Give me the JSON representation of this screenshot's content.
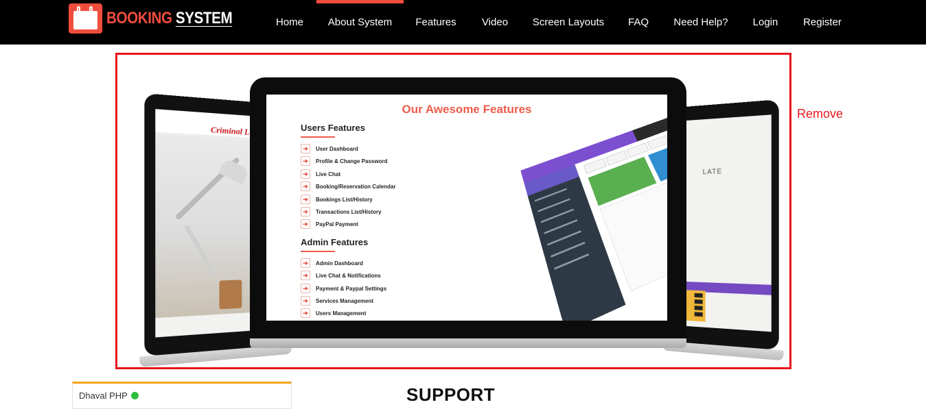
{
  "header": {
    "logo": {
      "word1": "BOOKING",
      "word2": "SYSTEM"
    },
    "nav": [
      {
        "label": "Home"
      },
      {
        "label": "About System",
        "active": true
      },
      {
        "label": "Features"
      },
      {
        "label": "Video"
      },
      {
        "label": "Screen Layouts"
      },
      {
        "label": "FAQ"
      },
      {
        "label": "Need Help?"
      },
      {
        "label": "Login"
      },
      {
        "label": "Register"
      }
    ]
  },
  "slider": {
    "remove_label": "Remove",
    "left_screen_script": "Criminal L",
    "right_screen_title": "LATE",
    "main_screen": {
      "title": "Our Awesome Features",
      "sections": [
        {
          "title": "Users Features",
          "items": [
            "User Dashboard",
            "Profile & Change Password",
            "Live Chat",
            "Booking/Reservation Calendar",
            "Bookings List/History",
            "Transactions List/History",
            "PayPal Payment"
          ]
        },
        {
          "title": "Admin Features",
          "items": [
            "Admin Dashboard",
            "Live Chat & Notifications",
            "Payment & Paypal Settings",
            "Services Management",
            "Users Management"
          ]
        }
      ]
    }
  },
  "chat": {
    "agent_name": "Dhaval PHP",
    "status_color": "#2ebd3f"
  },
  "support_heading": "SUPPORT",
  "colors": {
    "accent": "#ef4d3d",
    "highlight_border": "#e8151b",
    "nav_bg": "#000000"
  }
}
